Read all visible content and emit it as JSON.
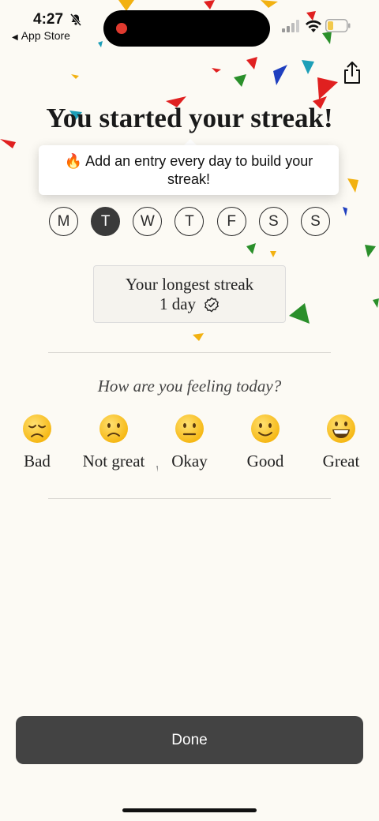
{
  "status_bar": {
    "time": "4:27",
    "back_label": "App Store"
  },
  "title": "You started your streak!",
  "tooltip": {
    "emoji": "🔥",
    "text": "Add an entry every day to build your streak!"
  },
  "week": {
    "days": [
      "M",
      "T",
      "W",
      "T",
      "F",
      "S",
      "S"
    ],
    "active_index": 1
  },
  "streak": {
    "line1": "Your longest streak",
    "line2": "1 day"
  },
  "question": "How are you feeling today?",
  "moods": [
    {
      "label": "Bad",
      "icon": "disappointed-face-icon"
    },
    {
      "label": "Not great",
      "icon": "slightly-frowning-face-icon"
    },
    {
      "label": "Okay",
      "icon": "neutral-face-icon"
    },
    {
      "label": "Good",
      "icon": "slightly-smiling-face-icon"
    },
    {
      "label": "Great",
      "icon": "grinning-face-icon"
    }
  ],
  "done_label": "Done",
  "colors": {
    "background": "#fcfaf4",
    "button": "#434343",
    "confetti": [
      "#e02020",
      "#2a8f2a",
      "#1f3fbf",
      "#f2b111",
      "#1d9fb8"
    ]
  }
}
